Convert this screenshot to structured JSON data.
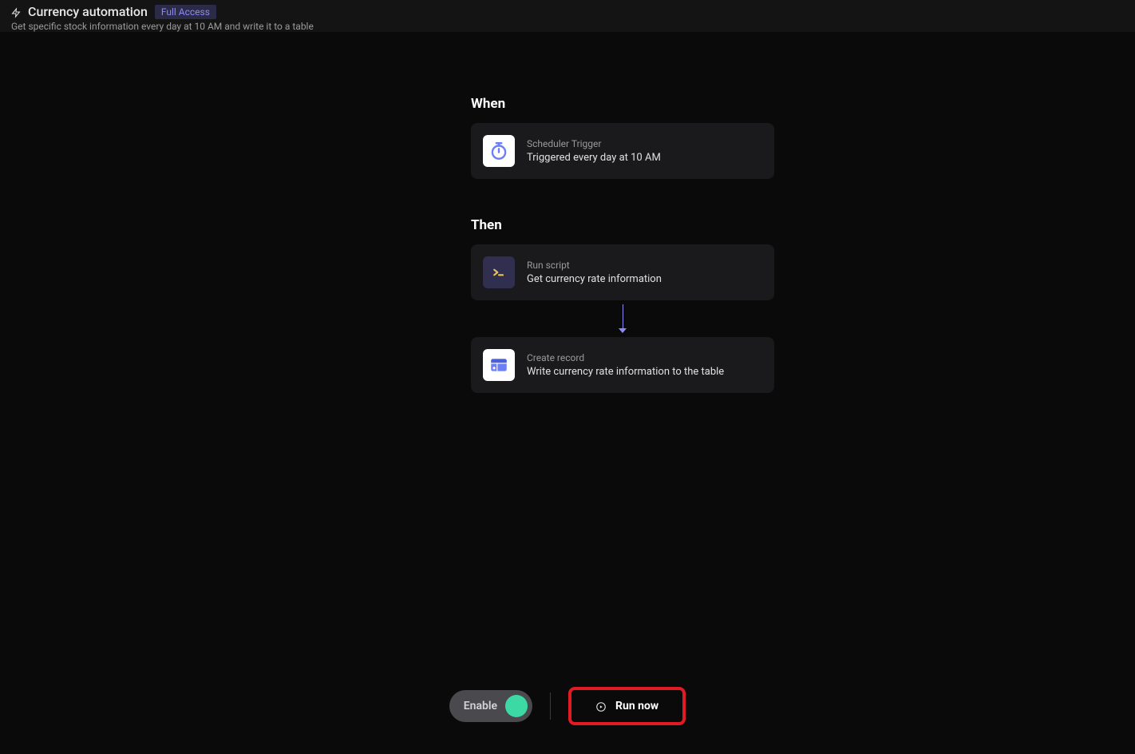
{
  "header": {
    "title": "Currency automation",
    "badge": "Full Access",
    "subtitle": "Get specific stock information every day at 10 AM and write it to a table"
  },
  "flow": {
    "when": {
      "label": "When",
      "trigger": {
        "type": "Scheduler Trigger",
        "description": "Triggered every day at 10 AM"
      }
    },
    "then": {
      "label": "Then",
      "steps": [
        {
          "type": "Run script",
          "description": "Get currency rate information",
          "icon": "terminal"
        },
        {
          "type": "Create record",
          "description": "Write currency rate information to the table",
          "icon": "table"
        }
      ]
    }
  },
  "footer": {
    "enable_label": "Enable",
    "run_label": "Run now"
  }
}
